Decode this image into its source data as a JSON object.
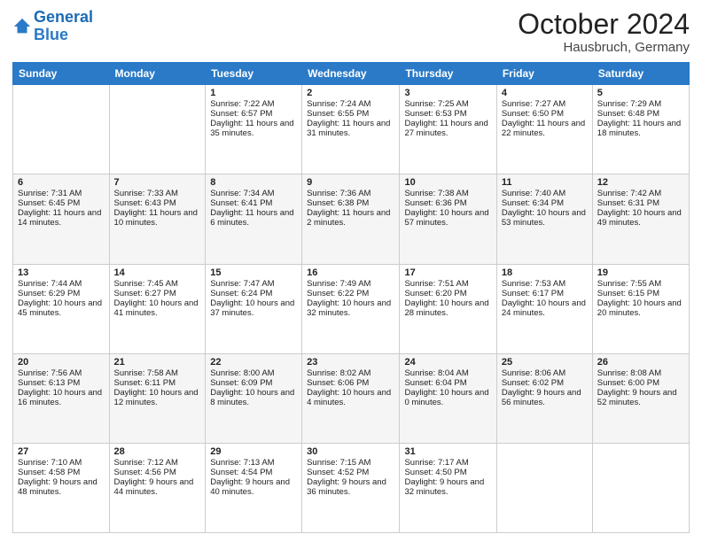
{
  "header": {
    "logo_text1": "General",
    "logo_text2": "Blue",
    "month": "October 2024",
    "location": "Hausbruch, Germany"
  },
  "weekdays": [
    "Sunday",
    "Monday",
    "Tuesday",
    "Wednesday",
    "Thursday",
    "Friday",
    "Saturday"
  ],
  "weeks": [
    [
      {
        "day": "",
        "sunrise": "",
        "sunset": "",
        "daylight": ""
      },
      {
        "day": "",
        "sunrise": "",
        "sunset": "",
        "daylight": ""
      },
      {
        "day": "1",
        "sunrise": "Sunrise: 7:22 AM",
        "sunset": "Sunset: 6:57 PM",
        "daylight": "Daylight: 11 hours and 35 minutes."
      },
      {
        "day": "2",
        "sunrise": "Sunrise: 7:24 AM",
        "sunset": "Sunset: 6:55 PM",
        "daylight": "Daylight: 11 hours and 31 minutes."
      },
      {
        "day": "3",
        "sunrise": "Sunrise: 7:25 AM",
        "sunset": "Sunset: 6:53 PM",
        "daylight": "Daylight: 11 hours and 27 minutes."
      },
      {
        "day": "4",
        "sunrise": "Sunrise: 7:27 AM",
        "sunset": "Sunset: 6:50 PM",
        "daylight": "Daylight: 11 hours and 22 minutes."
      },
      {
        "day": "5",
        "sunrise": "Sunrise: 7:29 AM",
        "sunset": "Sunset: 6:48 PM",
        "daylight": "Daylight: 11 hours and 18 minutes."
      }
    ],
    [
      {
        "day": "6",
        "sunrise": "Sunrise: 7:31 AM",
        "sunset": "Sunset: 6:45 PM",
        "daylight": "Daylight: 11 hours and 14 minutes."
      },
      {
        "day": "7",
        "sunrise": "Sunrise: 7:33 AM",
        "sunset": "Sunset: 6:43 PM",
        "daylight": "Daylight: 11 hours and 10 minutes."
      },
      {
        "day": "8",
        "sunrise": "Sunrise: 7:34 AM",
        "sunset": "Sunset: 6:41 PM",
        "daylight": "Daylight: 11 hours and 6 minutes."
      },
      {
        "day": "9",
        "sunrise": "Sunrise: 7:36 AM",
        "sunset": "Sunset: 6:38 PM",
        "daylight": "Daylight: 11 hours and 2 minutes."
      },
      {
        "day": "10",
        "sunrise": "Sunrise: 7:38 AM",
        "sunset": "Sunset: 6:36 PM",
        "daylight": "Daylight: 10 hours and 57 minutes."
      },
      {
        "day": "11",
        "sunrise": "Sunrise: 7:40 AM",
        "sunset": "Sunset: 6:34 PM",
        "daylight": "Daylight: 10 hours and 53 minutes."
      },
      {
        "day": "12",
        "sunrise": "Sunrise: 7:42 AM",
        "sunset": "Sunset: 6:31 PM",
        "daylight": "Daylight: 10 hours and 49 minutes."
      }
    ],
    [
      {
        "day": "13",
        "sunrise": "Sunrise: 7:44 AM",
        "sunset": "Sunset: 6:29 PM",
        "daylight": "Daylight: 10 hours and 45 minutes."
      },
      {
        "day": "14",
        "sunrise": "Sunrise: 7:45 AM",
        "sunset": "Sunset: 6:27 PM",
        "daylight": "Daylight: 10 hours and 41 minutes."
      },
      {
        "day": "15",
        "sunrise": "Sunrise: 7:47 AM",
        "sunset": "Sunset: 6:24 PM",
        "daylight": "Daylight: 10 hours and 37 minutes."
      },
      {
        "day": "16",
        "sunrise": "Sunrise: 7:49 AM",
        "sunset": "Sunset: 6:22 PM",
        "daylight": "Daylight: 10 hours and 32 minutes."
      },
      {
        "day": "17",
        "sunrise": "Sunrise: 7:51 AM",
        "sunset": "Sunset: 6:20 PM",
        "daylight": "Daylight: 10 hours and 28 minutes."
      },
      {
        "day": "18",
        "sunrise": "Sunrise: 7:53 AM",
        "sunset": "Sunset: 6:17 PM",
        "daylight": "Daylight: 10 hours and 24 minutes."
      },
      {
        "day": "19",
        "sunrise": "Sunrise: 7:55 AM",
        "sunset": "Sunset: 6:15 PM",
        "daylight": "Daylight: 10 hours and 20 minutes."
      }
    ],
    [
      {
        "day": "20",
        "sunrise": "Sunrise: 7:56 AM",
        "sunset": "Sunset: 6:13 PM",
        "daylight": "Daylight: 10 hours and 16 minutes."
      },
      {
        "day": "21",
        "sunrise": "Sunrise: 7:58 AM",
        "sunset": "Sunset: 6:11 PM",
        "daylight": "Daylight: 10 hours and 12 minutes."
      },
      {
        "day": "22",
        "sunrise": "Sunrise: 8:00 AM",
        "sunset": "Sunset: 6:09 PM",
        "daylight": "Daylight: 10 hours and 8 minutes."
      },
      {
        "day": "23",
        "sunrise": "Sunrise: 8:02 AM",
        "sunset": "Sunset: 6:06 PM",
        "daylight": "Daylight: 10 hours and 4 minutes."
      },
      {
        "day": "24",
        "sunrise": "Sunrise: 8:04 AM",
        "sunset": "Sunset: 6:04 PM",
        "daylight": "Daylight: 10 hours and 0 minutes."
      },
      {
        "day": "25",
        "sunrise": "Sunrise: 8:06 AM",
        "sunset": "Sunset: 6:02 PM",
        "daylight": "Daylight: 9 hours and 56 minutes."
      },
      {
        "day": "26",
        "sunrise": "Sunrise: 8:08 AM",
        "sunset": "Sunset: 6:00 PM",
        "daylight": "Daylight: 9 hours and 52 minutes."
      }
    ],
    [
      {
        "day": "27",
        "sunrise": "Sunrise: 7:10 AM",
        "sunset": "Sunset: 4:58 PM",
        "daylight": "Daylight: 9 hours and 48 minutes."
      },
      {
        "day": "28",
        "sunrise": "Sunrise: 7:12 AM",
        "sunset": "Sunset: 4:56 PM",
        "daylight": "Daylight: 9 hours and 44 minutes."
      },
      {
        "day": "29",
        "sunrise": "Sunrise: 7:13 AM",
        "sunset": "Sunset: 4:54 PM",
        "daylight": "Daylight: 9 hours and 40 minutes."
      },
      {
        "day": "30",
        "sunrise": "Sunrise: 7:15 AM",
        "sunset": "Sunset: 4:52 PM",
        "daylight": "Daylight: 9 hours and 36 minutes."
      },
      {
        "day": "31",
        "sunrise": "Sunrise: 7:17 AM",
        "sunset": "Sunset: 4:50 PM",
        "daylight": "Daylight: 9 hours and 32 minutes."
      },
      {
        "day": "",
        "sunrise": "",
        "sunset": "",
        "daylight": ""
      },
      {
        "day": "",
        "sunrise": "",
        "sunset": "",
        "daylight": ""
      }
    ]
  ]
}
